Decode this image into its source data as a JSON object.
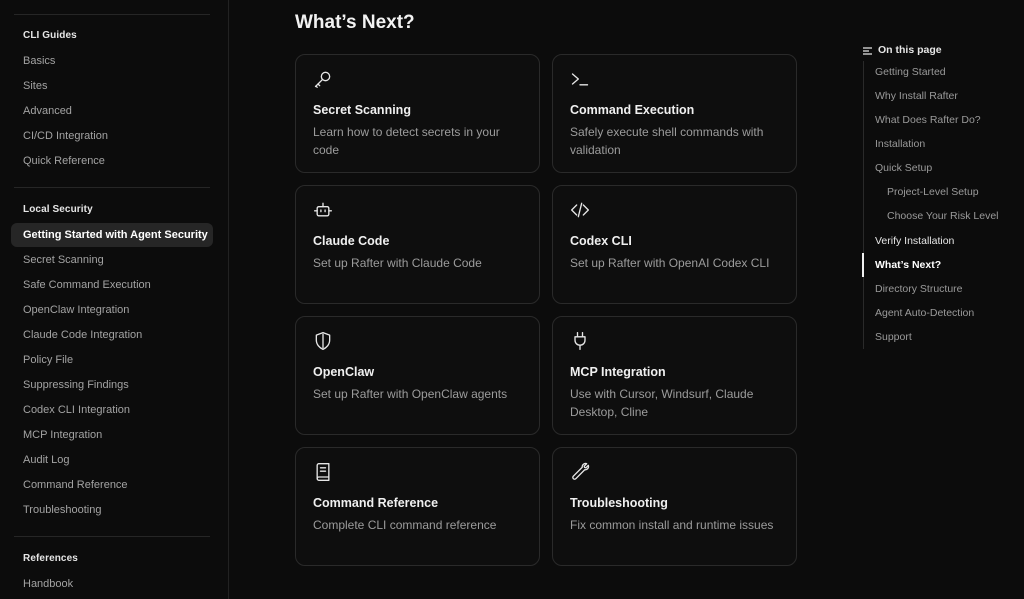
{
  "sidebar": {
    "sections": [
      {
        "heading": "CLI Guides",
        "items": [
          "Basics",
          "Sites",
          "Advanced",
          "CI/CD Integration",
          "Quick Reference"
        ]
      },
      {
        "heading": "Local Security",
        "items": [
          "Getting Started with Agent Security",
          "Secret Scanning",
          "Safe Command Execution",
          "OpenClaw Integration",
          "Claude Code Integration",
          "Policy File",
          "Suppressing Findings",
          "Codex CLI Integration",
          "MCP Integration",
          "Audit Log",
          "Command Reference",
          "Troubleshooting"
        ]
      },
      {
        "heading": "References",
        "items": [
          "Handbook"
        ]
      }
    ],
    "active_item": "Getting Started with Agent Security"
  },
  "main": {
    "title": "What’s Next?",
    "cards": [
      {
        "icon": "key-icon",
        "title": "Secret Scanning",
        "desc": "Learn how to detect secrets in your code"
      },
      {
        "icon": "terminal-icon",
        "title": "Command Execution",
        "desc": "Safely execute shell commands with validation"
      },
      {
        "icon": "robot-icon",
        "title": "Claude Code",
        "desc": "Set up Rafter with Claude Code"
      },
      {
        "icon": "code-icon",
        "title": "Codex CLI",
        "desc": "Set up Rafter with OpenAI Codex CLI"
      },
      {
        "icon": "shield-icon",
        "title": "OpenClaw",
        "desc": "Set up Rafter with OpenClaw agents"
      },
      {
        "icon": "plug-icon",
        "title": "MCP Integration",
        "desc": "Use with Cursor, Windsurf, Claude Desktop, Cline"
      },
      {
        "icon": "book-icon",
        "title": "Command Reference",
        "desc": "Complete CLI command reference"
      },
      {
        "icon": "wrench-icon",
        "title": "Troubleshooting",
        "desc": "Fix common install and runtime issues"
      }
    ]
  },
  "toc": {
    "heading": "On this page",
    "items": [
      {
        "label": "Getting Started"
      },
      {
        "label": "Why Install Rafter"
      },
      {
        "label": "What Does Rafter Do?"
      },
      {
        "label": "Installation"
      },
      {
        "label": "Quick Setup"
      },
      {
        "label": "Project-Level Setup",
        "sub": true
      },
      {
        "label": "Choose Your Risk Level",
        "sub": true
      },
      {
        "label": "Verify Installation",
        "bright": true
      },
      {
        "label": "What’s Next?",
        "active": true
      },
      {
        "label": "Directory Structure"
      },
      {
        "label": "Agent Auto-Detection"
      },
      {
        "label": "Support"
      }
    ]
  }
}
